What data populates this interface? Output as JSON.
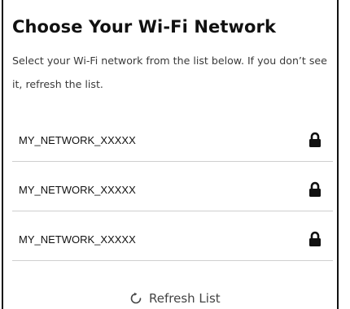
{
  "header": {
    "title": "Choose Your Wi-Fi Network",
    "subtitle": "Select your Wi-Fi network from the list below. If you don’t see it, refresh the list."
  },
  "networks": [
    {
      "name": "MY_NETWORK_XXXXX",
      "icon": "lock-icon"
    },
    {
      "name": "MY_NETWORK_XXXXX",
      "icon": "lock-icon"
    },
    {
      "name": "MY_NETWORK_XXXXX",
      "icon": "lock-icon"
    }
  ],
  "refresh": {
    "label": "Refresh List",
    "icon": "refresh-icon"
  },
  "colors": {
    "text": "#111111",
    "divider": "#cfcfcf",
    "border": "#111111"
  }
}
